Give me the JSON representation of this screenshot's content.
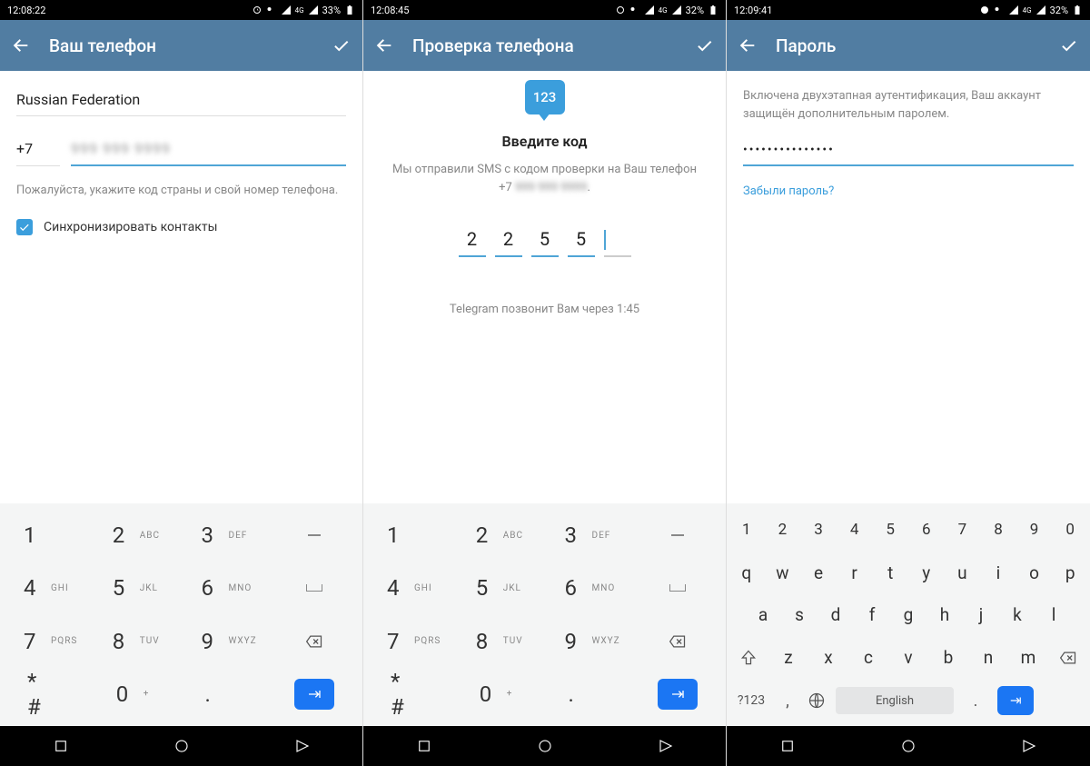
{
  "screens": [
    {
      "status": {
        "time": "12:08:22",
        "battery_pct": "33%",
        "net": "4G"
      },
      "app_bar_title": "Ваш телефон",
      "country": "Russian Federation",
      "prefix": "+7",
      "hint": "Пожалуйста, укажите код страны и свой номер телефона.",
      "sync_label": "Синхронизировать контакты"
    },
    {
      "status": {
        "time": "12:08:45",
        "battery_pct": "32%",
        "net": "4G"
      },
      "app_bar_title": "Проверка телефона",
      "chat_icon_text": "123",
      "title": "Введите код",
      "sms_line1": "Мы отправили SMS с кодом проверки на Ваш телефон",
      "sms_prefix": "+7",
      "code": [
        "2",
        "2",
        "5",
        "5",
        ""
      ],
      "call_text": "Telegram позвонит Вам через 1:45"
    },
    {
      "status": {
        "time": "12:09:41",
        "battery_pct": "32%",
        "net": "4G"
      },
      "app_bar_title": "Пароль",
      "tfa_text": "Включена двухэтапная аутентификация, Ваш аккаунт защищён дополнительным паролем.",
      "password_masked": "•••••••••••••••",
      "forgot": "Забыли пароль?"
    }
  ],
  "numpad_keys": [
    {
      "num": "1",
      "let": ""
    },
    {
      "num": "2",
      "let": "ABC"
    },
    {
      "num": "3",
      "let": "DEF"
    },
    {
      "num": "4",
      "let": "GHI"
    },
    {
      "num": "5",
      "let": "JKL"
    },
    {
      "num": "6",
      "let": "MNO"
    },
    {
      "num": "7",
      "let": "PQRS"
    },
    {
      "num": "8",
      "let": "TUV"
    },
    {
      "num": "9",
      "let": "WXYZ"
    },
    {
      "num": "* #",
      "let": ""
    },
    {
      "num": "0",
      "let": "+"
    },
    {
      "num": ".",
      "let": ""
    }
  ],
  "qwerty": {
    "nums": [
      "1",
      "2",
      "3",
      "4",
      "5",
      "6",
      "7",
      "8",
      "9",
      "0"
    ],
    "row1": [
      "q",
      "w",
      "e",
      "r",
      "t",
      "y",
      "u",
      "i",
      "o",
      "p"
    ],
    "row2": [
      "a",
      "s",
      "d",
      "f",
      "g",
      "h",
      "j",
      "k",
      "l"
    ],
    "row3": [
      "z",
      "x",
      "c",
      "v",
      "b",
      "n",
      "m"
    ],
    "sym_key": "?123",
    "comma": ",",
    "dot": ".",
    "lang": "English"
  }
}
